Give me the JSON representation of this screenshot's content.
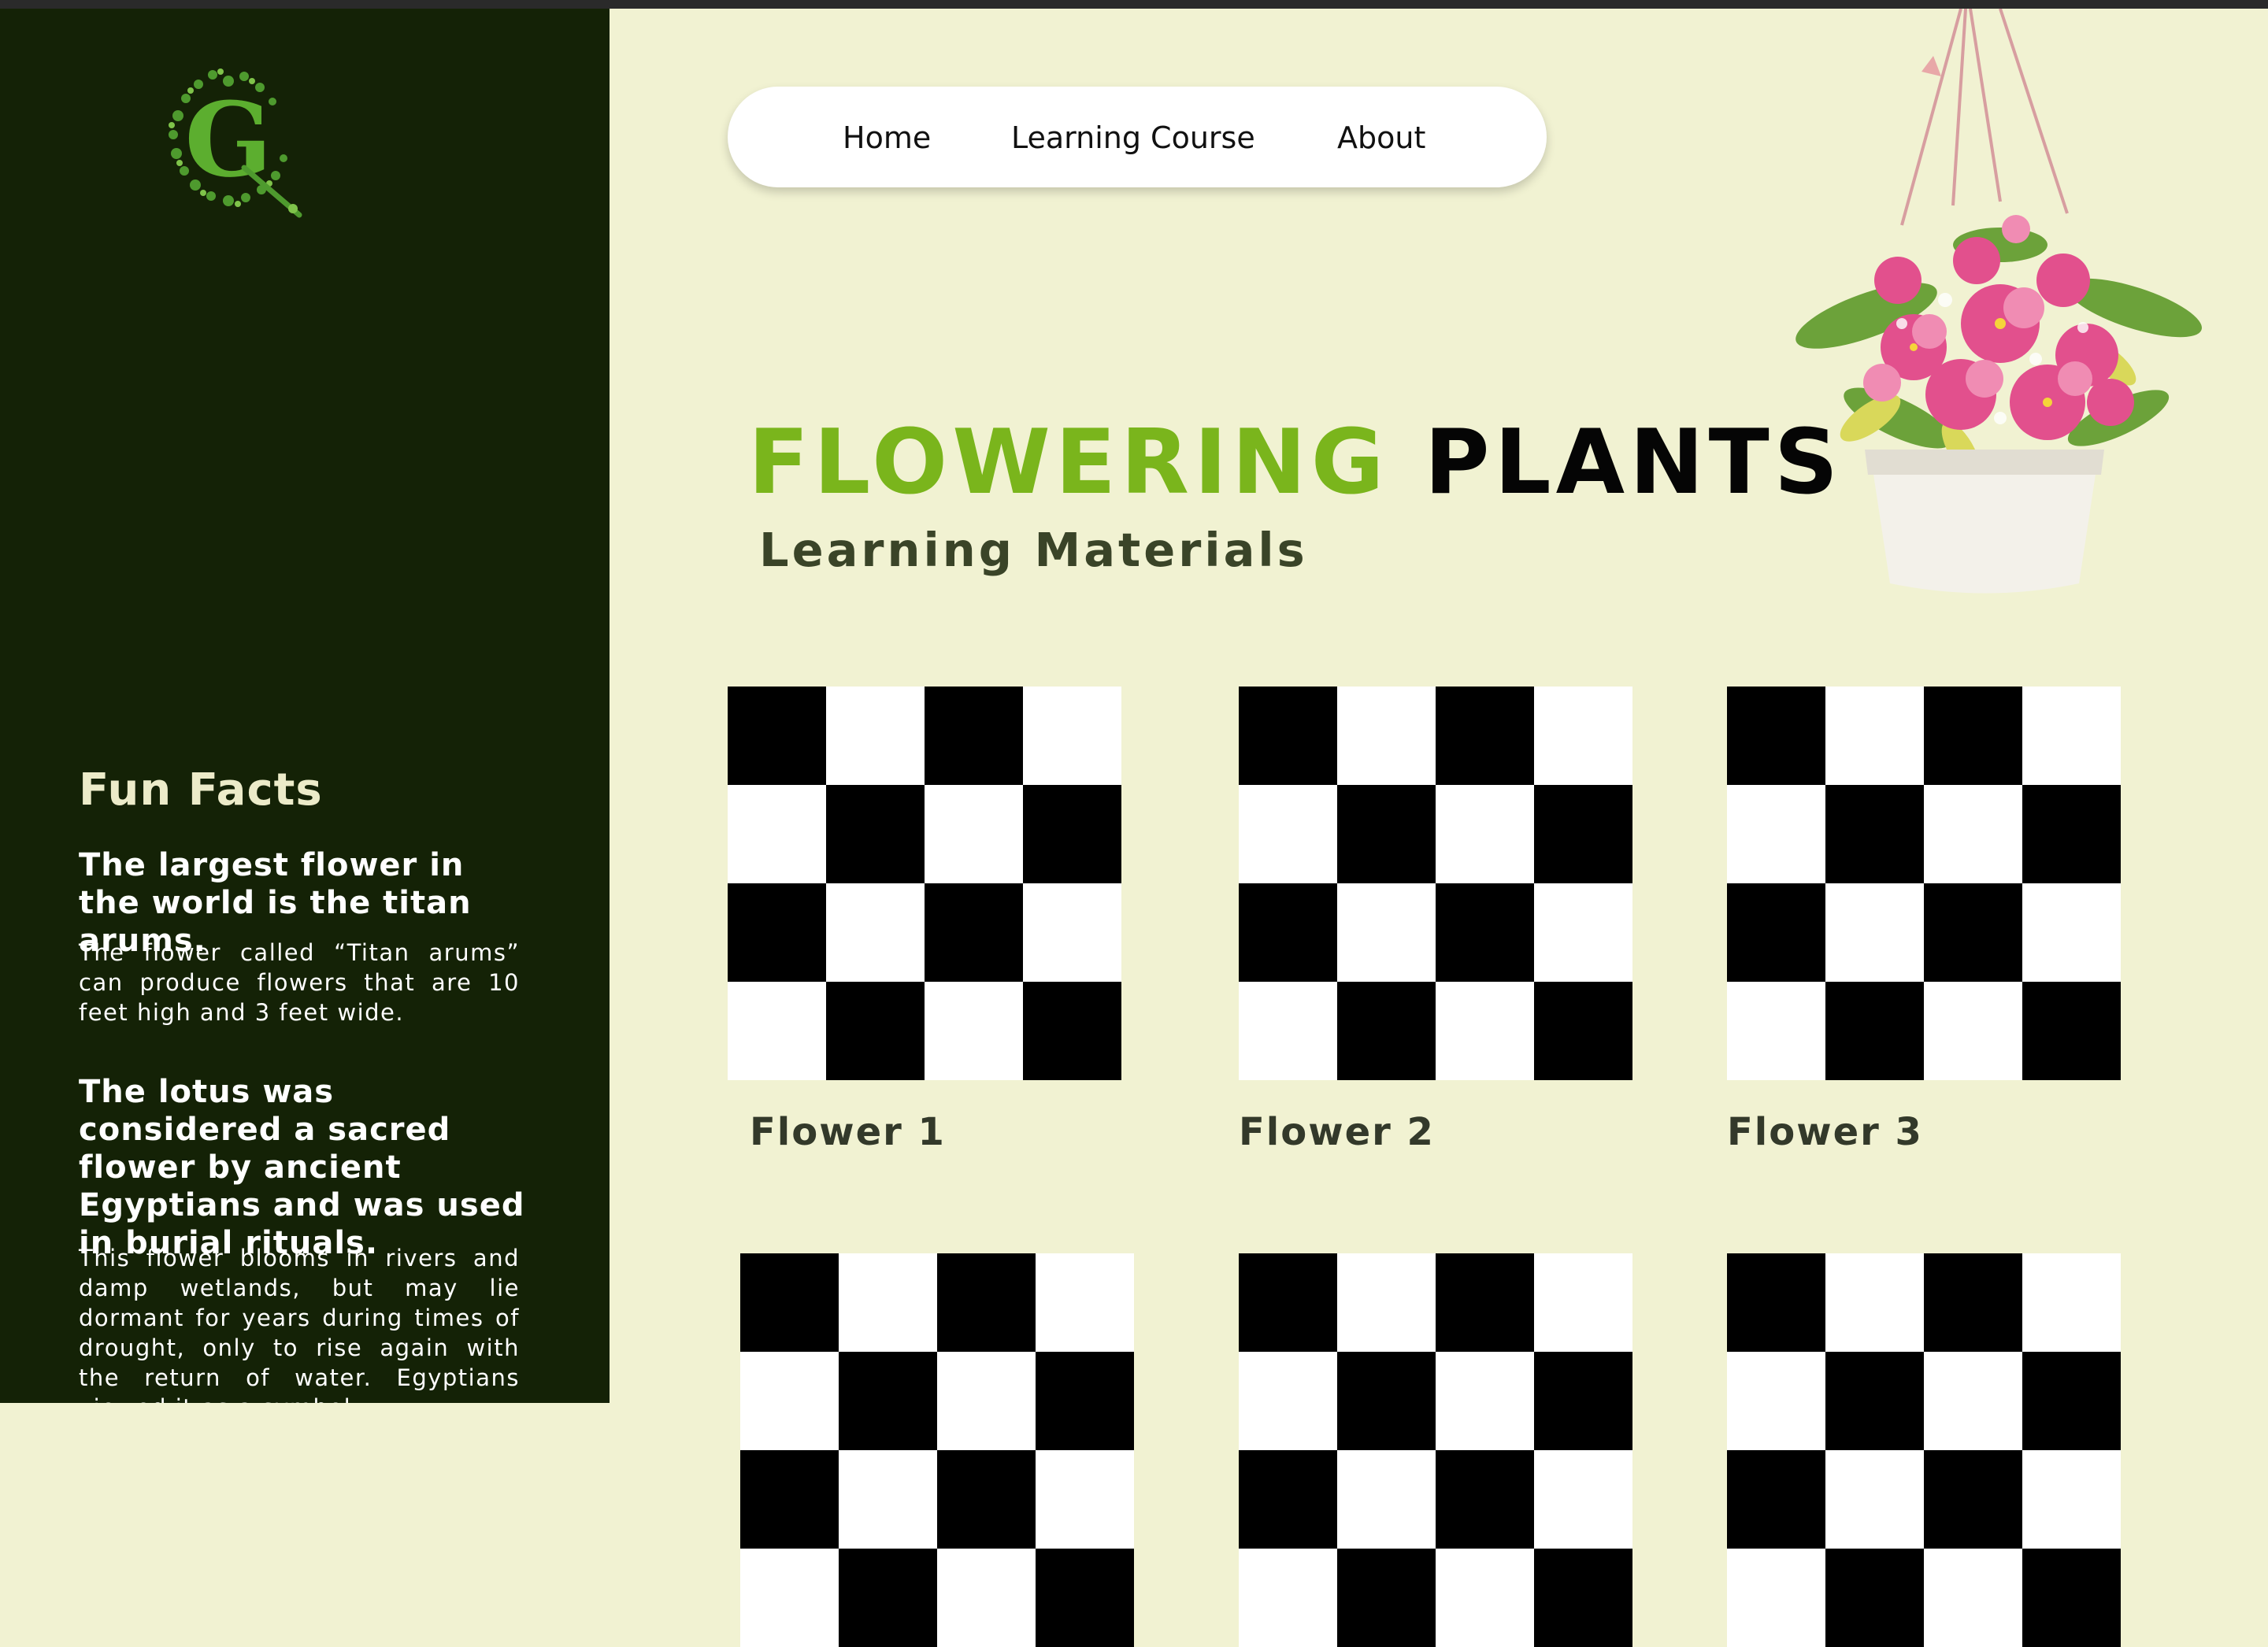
{
  "nav": {
    "home": "Home",
    "learning": "Learning Course",
    "about": "About"
  },
  "hero": {
    "title_green": "FLOWERING",
    "title_black": "PLANTS",
    "subtitle": "Learning Materials"
  },
  "sidebar": {
    "logo_icon": "floral-g-logo",
    "fun_facts_title": "Fun Facts",
    "facts": [
      {
        "heading": "The largest flower in the world is the titan arums.",
        "body": "The flower called “Titan arums” can produce flowers that are 10 feet high and 3 feet wide."
      },
      {
        "heading": "The lotus was considered a sacred flower by ancient Egyptians and was used in burial rituals.",
        "body": "This flower blooms in rivers and damp wetlands, but may lie dormant for years during times of drought, only to rise again with the return of water. Egyptians viewed it as a symbol"
      }
    ]
  },
  "cards": [
    {
      "label": "Flower 1",
      "icon": "checker-placeholder-image"
    },
    {
      "label": "Flower 2",
      "icon": "checker-placeholder-image"
    },
    {
      "label": "Flower 3",
      "icon": "checker-placeholder-image"
    },
    {
      "label": "",
      "icon": "checker-placeholder-image"
    },
    {
      "label": "",
      "icon": "checker-placeholder-image"
    },
    {
      "label": "",
      "icon": "checker-placeholder-image"
    }
  ],
  "colors": {
    "sidebar": "#142206",
    "page": "#f1f2d2",
    "accent": "#7ab51c"
  }
}
